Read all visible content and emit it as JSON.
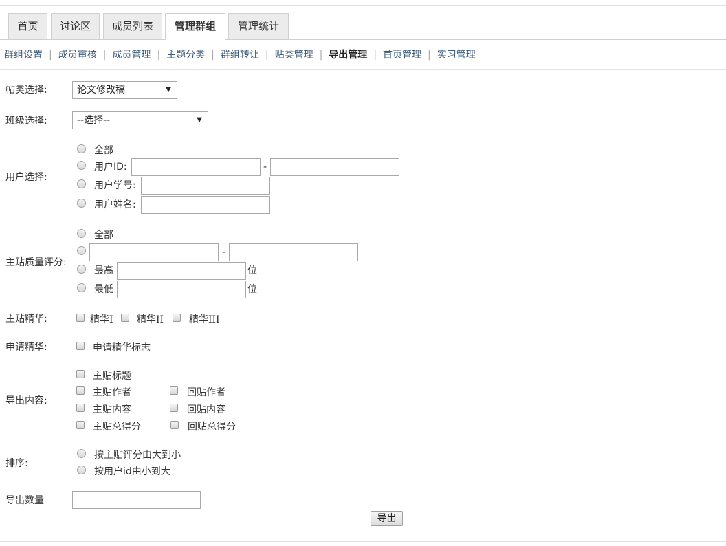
{
  "tabs": [
    "首页",
    "讨论区",
    "成员列表",
    "管理群组",
    "管理统计"
  ],
  "subnav": [
    "群组设置",
    "成员审核",
    "成员管理",
    "主题分类",
    "群组转让",
    "贴类管理",
    "导出管理",
    "首页管理",
    "实习管理"
  ],
  "subnav_separator": "|",
  "post_type": {
    "label": "帖类选择:",
    "value": "论文修改稿",
    "arrow": "▼"
  },
  "class_select": {
    "label": "班级选择:",
    "value": "--选择--",
    "arrow": "▼"
  },
  "user_select": {
    "label": "用户选择:",
    "all": "全部",
    "id_label": "用户ID:",
    "dash": "-",
    "student_no_label": "用户学号:",
    "name_label": "用户姓名:"
  },
  "quality": {
    "label": "主贴质量评分:",
    "all": "全部",
    "dash": "-",
    "highest": "最高",
    "lowest": "最低",
    "unit": "位"
  },
  "essence": {
    "label": "主贴精华:",
    "options": [
      "精华I",
      "精华II",
      "精华III"
    ]
  },
  "apply_essence": {
    "label": "申请精华:",
    "option": "申请精华标志"
  },
  "export_content": {
    "label": "导出内容:",
    "post_title": "主贴标题",
    "post_author": "主贴作者",
    "reply_author": "回贴作者",
    "post_content": "主贴内容",
    "reply_content": "回贴内容",
    "post_score": "主贴总得分",
    "reply_score": "回贴总得分"
  },
  "sort": {
    "label": "排序:",
    "options": [
      "按主贴评分由大到小",
      "按用户id由小到大"
    ]
  },
  "export_count": {
    "label": "导出数量",
    "value": ""
  },
  "export_button": "导出"
}
